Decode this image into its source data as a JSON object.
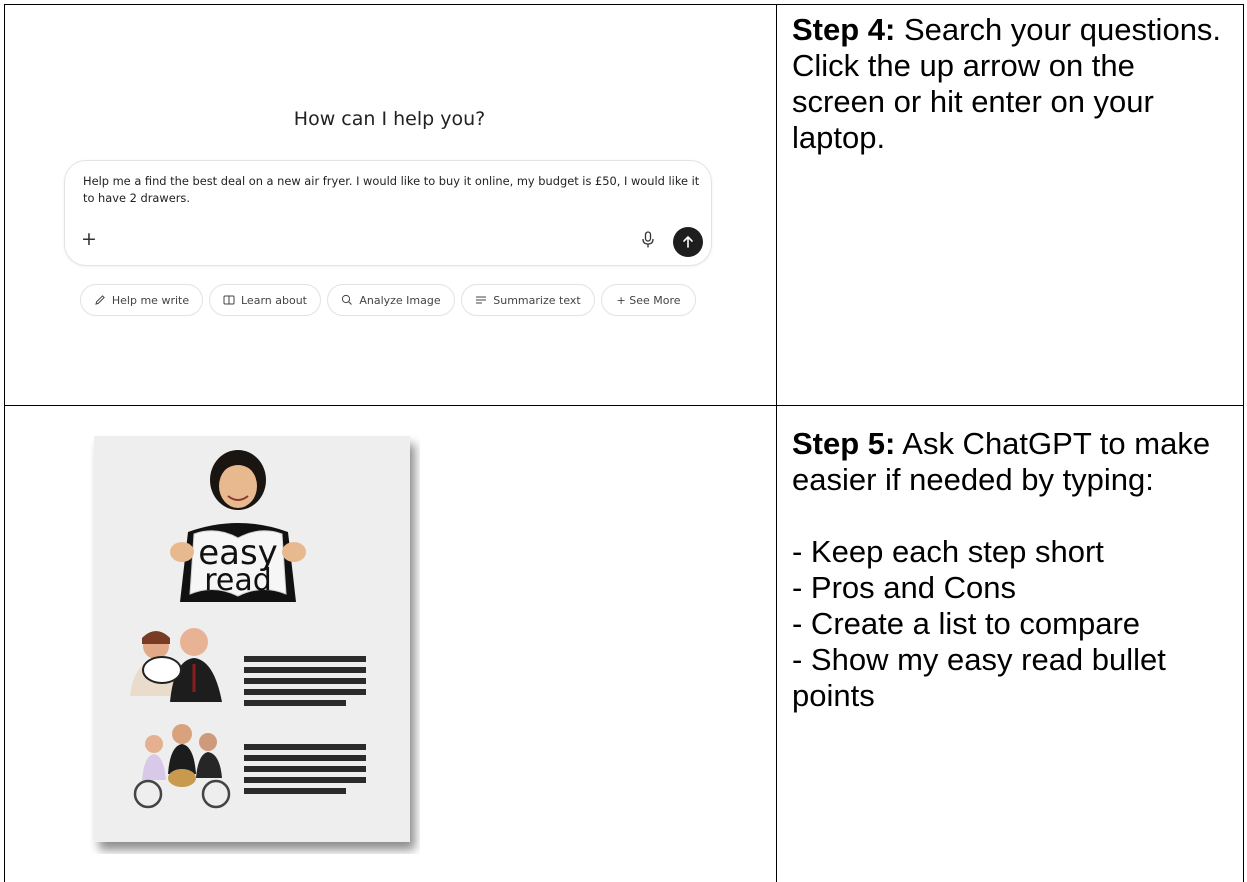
{
  "chat": {
    "title": "How can I help you?",
    "message": "Help me a find the best deal on a new air fryer. I would like to buy it online, my budget is £50, I would like it to have 2 drawers.",
    "plus_label": "+",
    "chips": [
      {
        "label": "Help me write",
        "icon": "pencil-icon"
      },
      {
        "label": "Learn about",
        "icon": "book-icon"
      },
      {
        "label": "Analyze Image",
        "icon": "magnifier-icon"
      },
      {
        "label": "Summarize text",
        "icon": "lines-icon"
      },
      {
        "label": "+ See More",
        "icon": ""
      }
    ]
  },
  "step4": {
    "heading": "Step 4:",
    "text": " Search your questions. Click the up arrow on the screen or hit enter on your laptop."
  },
  "step5": {
    "heading": "Step 5:",
    "text": " Ask ChatGPT to make easier if needed by typing:",
    "tips": [
      "- Keep each step short",
      "- Pros and Cons",
      "- Create a list to compare",
      "- Show my easy read bullet points"
    ]
  },
  "illustration": {
    "word1": "easy",
    "word2": "read"
  },
  "colors": {
    "send_button": "#1e1e1e",
    "border": "#000000"
  }
}
